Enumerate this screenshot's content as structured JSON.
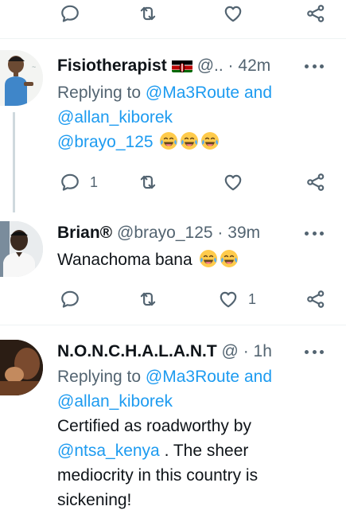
{
  "tweets": [
    {
      "name": "Fisiotherapist",
      "handle": "@..",
      "separator": "·",
      "time": "42m",
      "reply_prefix": "Replying to",
      "reply_user1": "@Ma3Route",
      "reply_and": "and",
      "reply_user2": "@allan_kiborek",
      "body_mention": "@brayo_125",
      "replies_count": "1",
      "likes_count": ""
    },
    {
      "name": "Brian®",
      "handle": "@brayo_125",
      "separator": "·",
      "time": "39m",
      "body_text": "Wanachoma bana",
      "replies_count": "",
      "likes_count": "1"
    },
    {
      "name": "N.O.N.C.H.A.L.A.N.T",
      "handle": "@",
      "separator": "·",
      "time": "1h",
      "reply_prefix": "Replying to",
      "reply_user1": "@Ma3Route",
      "reply_and": "and",
      "reply_user2": "@allan_kiborek",
      "body_line1": "Certified as roadworthy by",
      "body_mention": "@ntsa_kenya",
      "body_line2_rest": " . The sheer",
      "body_line3": "mediocrity in this country is",
      "body_line4": "sickening!"
    }
  ],
  "icons": {
    "reply": "reply-icon",
    "retweet": "retweet-icon",
    "like": "heart-icon",
    "share": "share-icon",
    "more": "more-icon"
  },
  "colors": {
    "link": "#1d9bf0",
    "secondary": "#536471",
    "text": "#0f1419",
    "divider": "#eff3f4"
  }
}
